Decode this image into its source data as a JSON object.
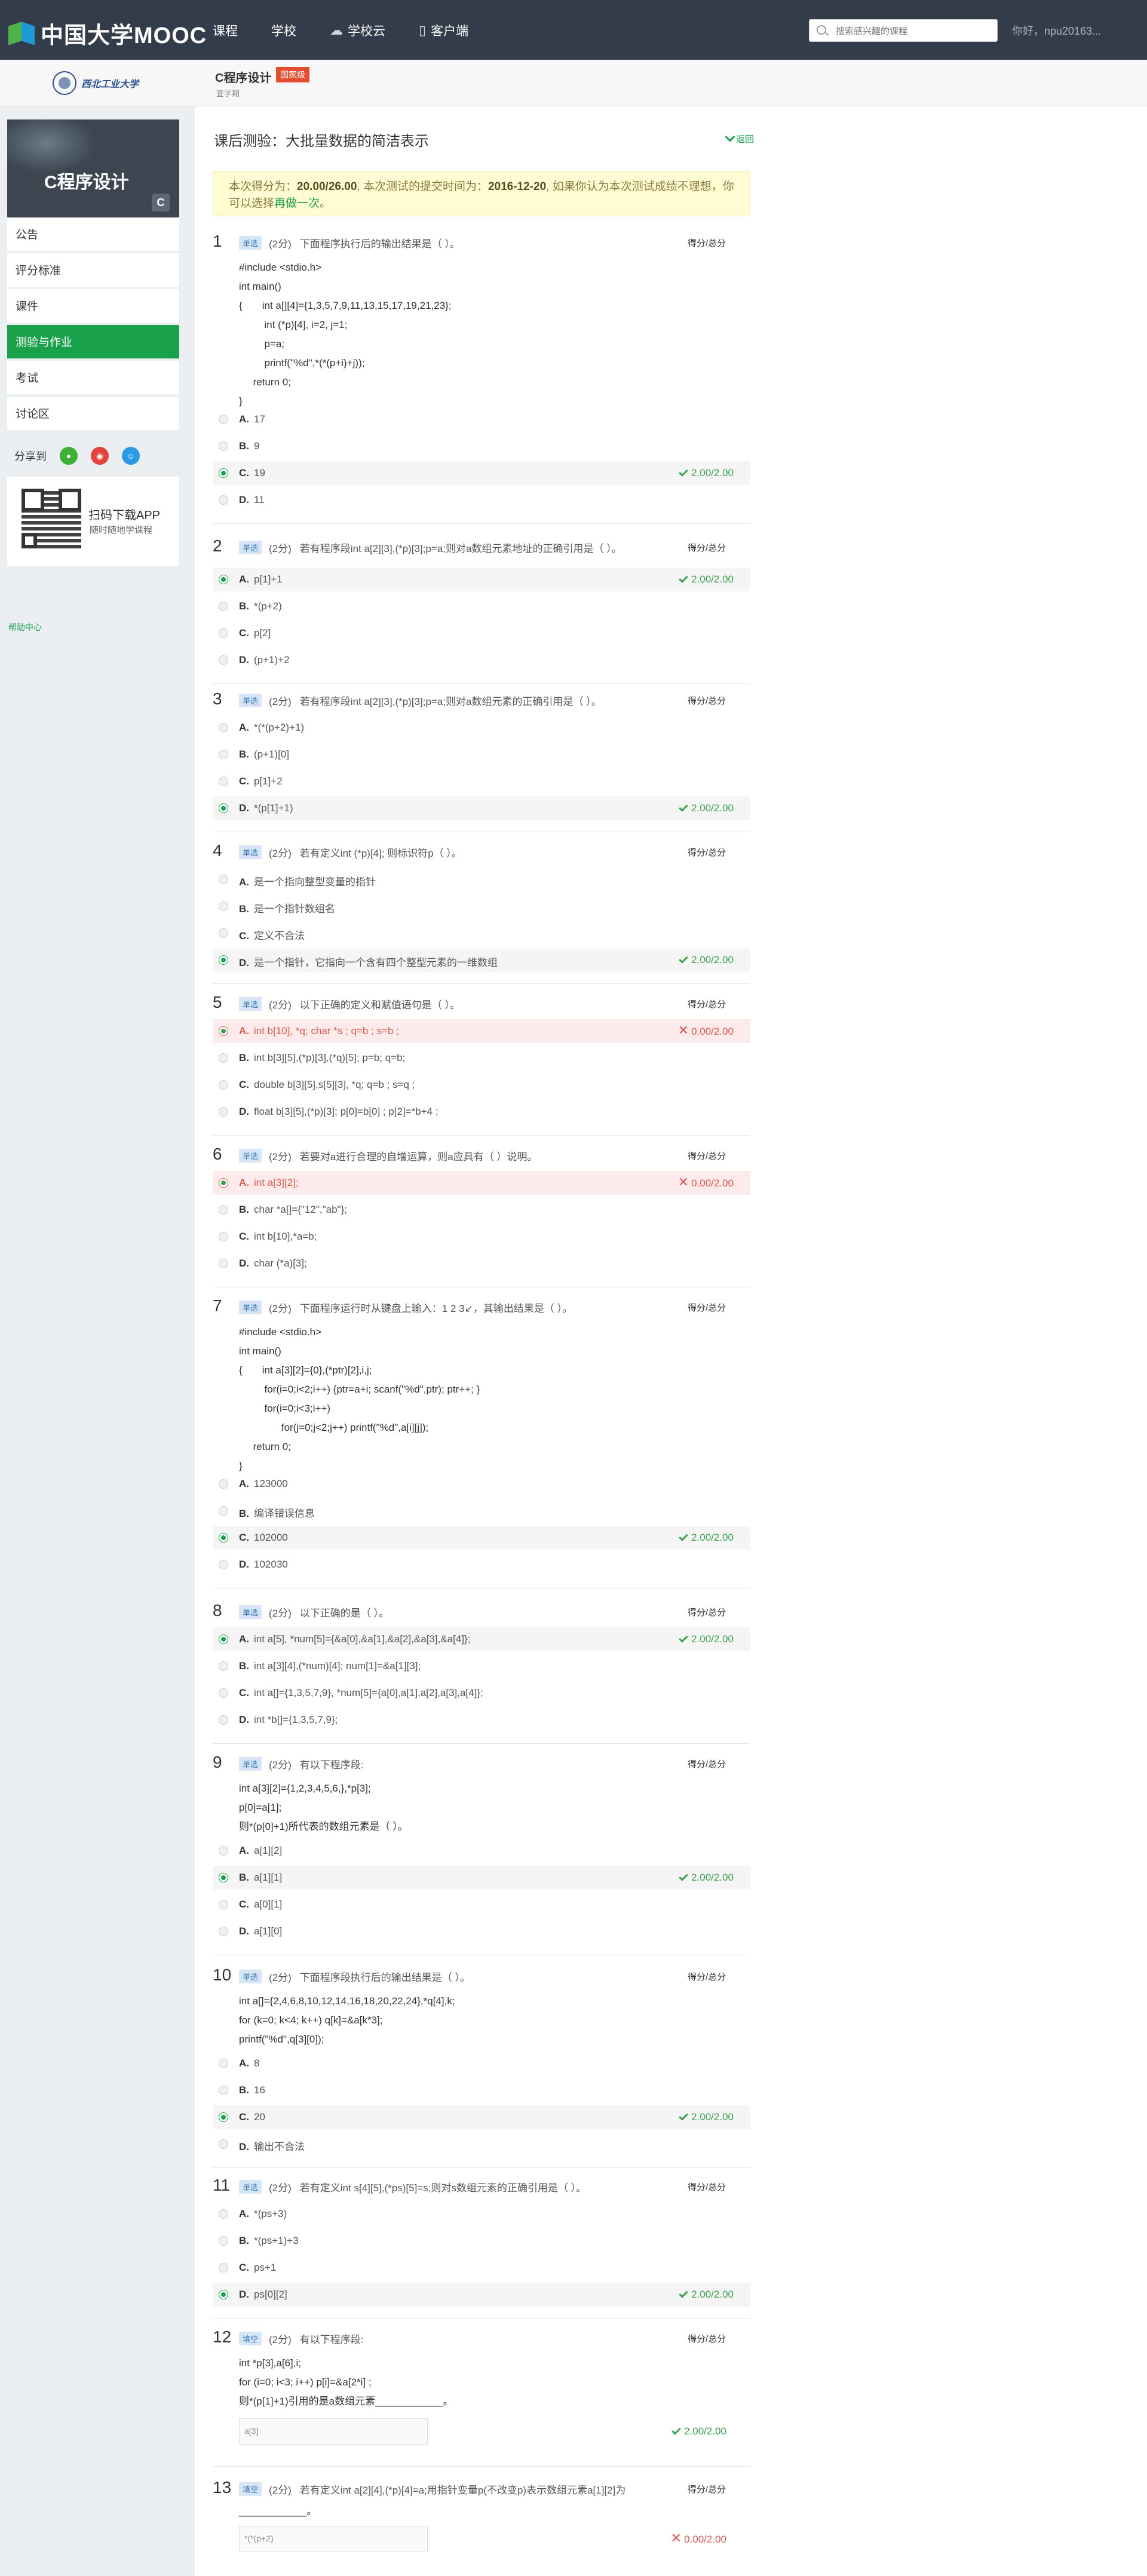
{
  "header": {
    "logo_text": "中国大学MOOC",
    "nav": [
      {
        "label": "课程",
        "icon": ""
      },
      {
        "label": "学校",
        "icon": ""
      },
      {
        "label": "学校云",
        "icon": "cloud-icon"
      },
      {
        "label": "客户端",
        "icon": "phone-icon"
      }
    ],
    "search_placeholder": "搜索感兴趣的课程",
    "user_greeting": "你好，npu20163..."
  },
  "subheader": {
    "school_name": "西北工业大学",
    "course_title": "C程序设计",
    "badge": "国家级",
    "course_sub": "查学期"
  },
  "sidebar": {
    "banner_text": "C程序设计",
    "items": [
      "公告",
      "评分标准",
      "课件",
      "测验与作业",
      "考试",
      "讨论区"
    ],
    "active_index": 3,
    "share_label": "分享到",
    "app_title": "扫码下载APP",
    "app_sub": "随时随地学课程",
    "help": "帮助中心"
  },
  "page": {
    "title": "课后测验：大批量数据的简洁表示",
    "back": "返回",
    "score_prefix": "本次得分为：",
    "score": "20.00/26.00",
    "score_mid": ", 本次测试的提交时间为：",
    "submit_date": "2016-12-20",
    "score_suffix": ", 如果你认为本次测试成绩不理想，你可以选择",
    "retry": "再做一次",
    "score_end": "。",
    "score_label": "得分/总分"
  },
  "questions": [
    {
      "num": "1",
      "type": "单选",
      "pts": "(2分)",
      "text": "下面程序执行后的输出结果是（ ）。",
      "code": [
        "#include <stdio.h>",
        "int main()",
        "{       int a[][4]={1,3,5,7,9,11,13,15,17,19,21,23};",
        "         int (*p)[4], i=2, j=1;",
        "         p=a;",
        "         printf(\"%d\",*(*(p+i)+j));",
        "     return 0;",
        "}"
      ],
      "options": [
        {
          "letter": "A.",
          "text": "17"
        },
        {
          "letter": "B.",
          "text": "9"
        },
        {
          "letter": "C.",
          "text": "19"
        },
        {
          "letter": "D.",
          "text": "11"
        }
      ],
      "result": "2.00/2.00"
    },
    {
      "num": "2",
      "type": "单选",
      "pts": "(2分)",
      "text": "若有程序段int a[2][3],(*p)[3];p=a;则对a数组元素地址的正确引用是（ ）。",
      "options": [
        {
          "letter": "A.",
          "text": "p[1]+1"
        },
        {
          "letter": "B.",
          "text": "*(p+2)"
        },
        {
          "letter": "C.",
          "text": "p[2]"
        },
        {
          "letter": "D.",
          "text": "(p+1)+2"
        }
      ],
      "result": "2.00/2.00"
    },
    {
      "num": "3",
      "type": "单选",
      "pts": "(2分)",
      "text": "若有程序段int a[2][3],(*p)[3];p=a;则对a数组元素的正确引用是（ ）。",
      "options": [
        {
          "letter": "A.",
          "text": "*(*(p+2)+1)"
        },
        {
          "letter": "B.",
          "text": "(p+1)[0]"
        },
        {
          "letter": "C.",
          "text": "p[1]+2"
        },
        {
          "letter": "D.",
          "text": "*(p[1]+1)"
        }
      ],
      "result": "2.00/2.00"
    },
    {
      "num": "4",
      "type": "单选",
      "pts": "(2分)",
      "text": "若有定义int (*p)[4]; 则标识符p（ ）。",
      "options": [
        {
          "letter": "A.",
          "text": "是一个指向整型变量的指针"
        },
        {
          "letter": "B.",
          "text": "是一个指针数组名"
        },
        {
          "letter": "C.",
          "text": "定义不合法"
        },
        {
          "letter": "D.",
          "text": "是一个指针，它指向一个含有四个整型元素的一维数组"
        }
      ],
      "result": "2.00/2.00"
    },
    {
      "num": "5",
      "type": "单选",
      "pts": "(2分)",
      "text": "以下正确的定义和赋值语句是（ ）。",
      "options": [
        {
          "letter": "A.",
          "text": "int b[10], *q; char *s ; q=b ; s=b ;"
        },
        {
          "letter": "B.",
          "text": "int b[3][5],(*p)[3],(*q)[5]; p=b; q=b;"
        },
        {
          "letter": "C.",
          "text": "double b[3][5],s[5][3], *q; q=b ; s=q ;"
        },
        {
          "letter": "D.",
          "text": "float b[3][5],(*p)[3]; p[0]=b[0] ; p[2]=*b+4 ;"
        }
      ],
      "result": "0.00/2.00"
    },
    {
      "num": "6",
      "type": "单选",
      "pts": "(2分)",
      "text": "若要对a进行合理的自增运算，则a应具有（ ）说明。",
      "options": [
        {
          "letter": "A.",
          "text": "int a[3][2];"
        },
        {
          "letter": "B.",
          "text": "char *a[]={\"12\",\"ab\"};"
        },
        {
          "letter": "C.",
          "text": "int b[10],*a=b;"
        },
        {
          "letter": "D.",
          "text": "char (*a)[3];"
        }
      ],
      "result": "0.00/2.00"
    },
    {
      "num": "7",
      "type": "单选",
      "pts": "(2分)",
      "text": "下面程序运行时从键盘上输入：1 2 3↙，其输出结果是（ ）。",
      "code": [
        "#include <stdio.h>",
        "int main()",
        "{       int a[3][2]={0},(*ptr)[2],i,j;",
        "         for(i=0;i<2;i++) {ptr=a+i; scanf(\"%d\",ptr); ptr++; }",
        "         for(i=0;i<3;i++)",
        "               for(j=0;j<2;j++) printf(\"%d\",a[i][j]);",
        "     return 0;",
        "}"
      ],
      "options": [
        {
          "letter": "A.",
          "text": "123000"
        },
        {
          "letter": "B.",
          "text": "编译错误信息"
        },
        {
          "letter": "C.",
          "text": "102000"
        },
        {
          "letter": "D.",
          "text": "102030"
        }
      ],
      "result": "2.00/2.00"
    },
    {
      "num": "8",
      "type": "单选",
      "pts": "(2分)",
      "text": "以下正确的是（ ）。",
      "options": [
        {
          "letter": "A.",
          "text": "int a[5], *num[5]={&a[0],&a[1],&a[2],&a[3],&a[4]};"
        },
        {
          "letter": "B.",
          "text": "int a[3][4],(*num)[4]; num[1]=&a[1][3];"
        },
        {
          "letter": "C.",
          "text": "int a[]={1,3,5,7,9}, *num[5]={a[0],a[1],a[2],a[3],a[4]};"
        },
        {
          "letter": "D.",
          "text": "int *b[]={1,3,5,7,9};"
        }
      ],
      "result": "2.00/2.00"
    },
    {
      "num": "9",
      "type": "单选",
      "pts": "(2分)",
      "text": "有以下程序段:",
      "code": [
        "int a[3][2]={1,2,3,4,5,6,},*p[3];",
        "p[0]=a[1];",
        "则*(p[0]+1)所代表的数组元素是（ ）。"
      ],
      "options": [
        {
          "letter": "A.",
          "text": "a[1][2]"
        },
        {
          "letter": "B.",
          "text": "a[1][1]"
        },
        {
          "letter": "C.",
          "text": "a[0][1]"
        },
        {
          "letter": "D.",
          "text": "a[1][0]"
        }
      ],
      "result": "2.00/2.00"
    },
    {
      "num": "10",
      "type": "单选",
      "pts": "(2分)",
      "text": "下面程序段执行后的输出结果是（ ）。",
      "code": [
        "int a[]={2,4,6,8,10,12,14,16,18,20,22,24},*q[4],k;",
        "for (k=0; k<4; k++) q[k]=&a[k*3];",
        "printf(\"%d\",q[3][0]);"
      ],
      "options": [
        {
          "letter": "A.",
          "text": "8"
        },
        {
          "letter": "B.",
          "text": "16"
        },
        {
          "letter": "C.",
          "text": "20"
        },
        {
          "letter": "D.",
          "text": "输出不合法"
        }
      ],
      "result": "2.00/2.00"
    },
    {
      "num": "11",
      "type": "单选",
      "pts": "(2分)",
      "text": "若有定义int s[4][5],(*ps)[5]=s;则对s数组元素的正确引用是（ ）。",
      "options": [
        {
          "letter": "A.",
          "text": "*(ps+3)"
        },
        {
          "letter": "B.",
          "text": "*(ps+1)+3"
        },
        {
          "letter": "C.",
          "text": "ps+1"
        },
        {
          "letter": "D.",
          "text": "ps[0][2]"
        }
      ],
      "result": "2.00/2.00"
    },
    {
      "num": "12",
      "type": "填空",
      "pts": "(2分)",
      "text": "有以下程序段:",
      "code": [
        "int *p[3],a[6],i;",
        "for (i=0; i<3; i++) p[i]=&a[2*i] ;",
        "则*(p[1]+1)引用的是a数组元素____________。"
      ],
      "answer": "a[3]",
      "result": "2.00/2.00"
    },
    {
      "num": "13",
      "type": "填空",
      "pts": "(2分)",
      "text": "若有定义int a[2][4],(*p)[4]=a;用指针变量p(不改变p)表示数组元素a[1][2]为",
      "code": [
        "____________。"
      ],
      "answer": "*(*(p+2)",
      "result": "0.00/2.00"
    }
  ]
}
